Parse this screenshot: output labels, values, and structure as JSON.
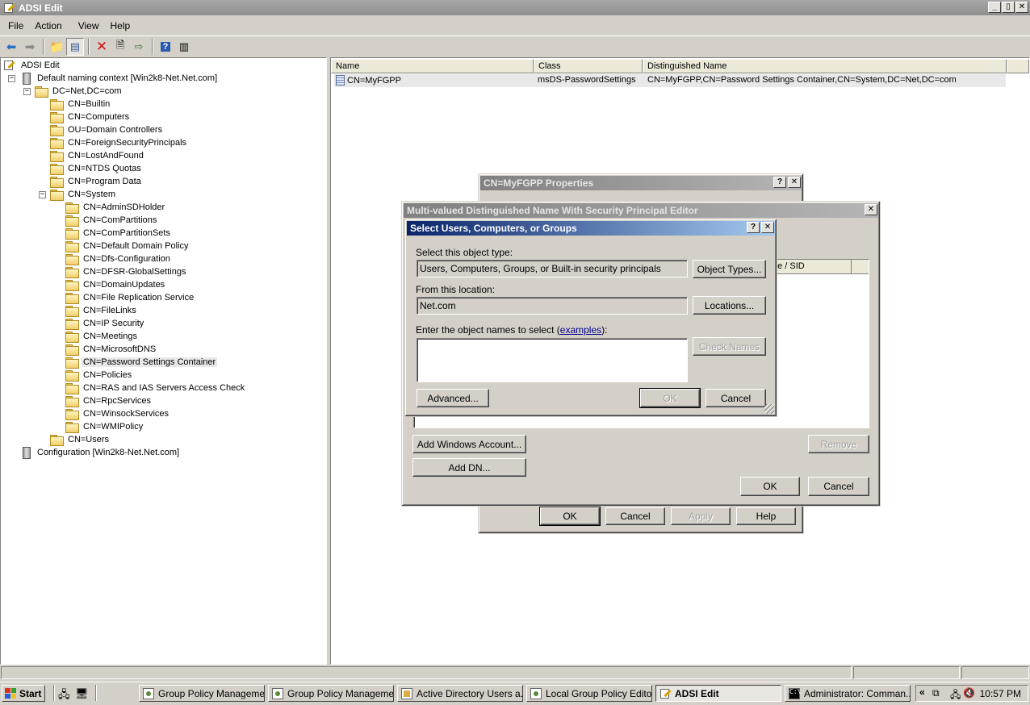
{
  "window": {
    "title": "ADSI Edit",
    "btn_min": "_",
    "btn_max": "▯",
    "btn_close": "✕"
  },
  "menubar": {
    "items": [
      "File",
      "Action",
      "View",
      "Help"
    ]
  },
  "tree": {
    "root": "ADSI Edit",
    "naming_context": "Default naming context [Win2k8-Net.Net.com]",
    "domain": "DC=Net,DC=com",
    "domain_children": [
      "CN=Builtin",
      "CN=Computers",
      "OU=Domain Controllers",
      "CN=ForeignSecurityPrincipals",
      "CN=LostAndFound",
      "CN=NTDS Quotas",
      "CN=Program Data"
    ],
    "system": "CN=System",
    "system_children": [
      "CN=AdminSDHolder",
      "CN=ComPartitions",
      "CN=ComPartitionSets",
      "CN=Default Domain Policy",
      "CN=Dfs-Configuration",
      "CN=DFSR-GlobalSettings",
      "CN=DomainUpdates",
      "CN=File Replication Service",
      "CN=FileLinks",
      "CN=IP Security",
      "CN=Meetings",
      "CN=MicrosoftDNS",
      "CN=Password Settings Container",
      "CN=Policies",
      "CN=RAS and IAS Servers Access Check",
      "CN=RpcServices",
      "CN=WinsockServices",
      "CN=WMIPolicy"
    ],
    "users": "CN=Users",
    "configuration": "Configuration [Win2k8-Net.Net.com]",
    "expand_minus": "−"
  },
  "list": {
    "headers": [
      "Name",
      "Class",
      "Distinguished Name"
    ],
    "row": {
      "name": "CN=MyFGPP",
      "class": "msDS-PasswordSettings",
      "dn": "CN=MyFGPP,CN=Password Settings Container,CN=System,DC=Net,DC=com"
    }
  },
  "props_dialog": {
    "title": "CN=MyFGPP Properties",
    "help": "?",
    "close": "✕",
    "ok": "OK",
    "cancel": "Cancel",
    "apply": "Apply",
    "help_btn": "Help"
  },
  "mv_dialog": {
    "title": "Multi-valued Distinguished Name With Security Principal Editor",
    "close": "✕",
    "col_partial": "ne / SID",
    "add_windows_account": "Add Windows Account...",
    "add_dn": "Add DN...",
    "remove": "Remove",
    "ok": "OK",
    "cancel": "Cancel"
  },
  "select_dialog": {
    "title": "Select Users, Computers, or Groups",
    "help": "?",
    "close": "✕",
    "object_type_label": "Select this object type:",
    "object_type_value": "Users, Computers, Groups, or Built-in security principals",
    "object_types_btn": "Object Types...",
    "location_label": "From this location:",
    "location_value": "Net.com",
    "locations_btn": "Locations...",
    "names_label_pre": "Enter the object names to select (",
    "names_label_link": "examples",
    "names_label_post": "):",
    "names_value": "",
    "check_names_btn": "Check Names",
    "advanced_btn": "Advanced...",
    "ok": "OK",
    "cancel": "Cancel"
  },
  "taskbar": {
    "start": "Start",
    "buttons": [
      "Group Policy Management",
      "Group Policy Manageme...",
      "Active Directory Users a...",
      "Local Group Policy Editor",
      "ADSI Edit",
      "Administrator: Comman..."
    ],
    "tray_chevron": "«",
    "clock": "10:57 PM"
  },
  "colors": {
    "title_active": "#0a246a",
    "title_inactive": "#808080",
    "link": "#00008b",
    "taskbar": "#d4d0c8"
  }
}
